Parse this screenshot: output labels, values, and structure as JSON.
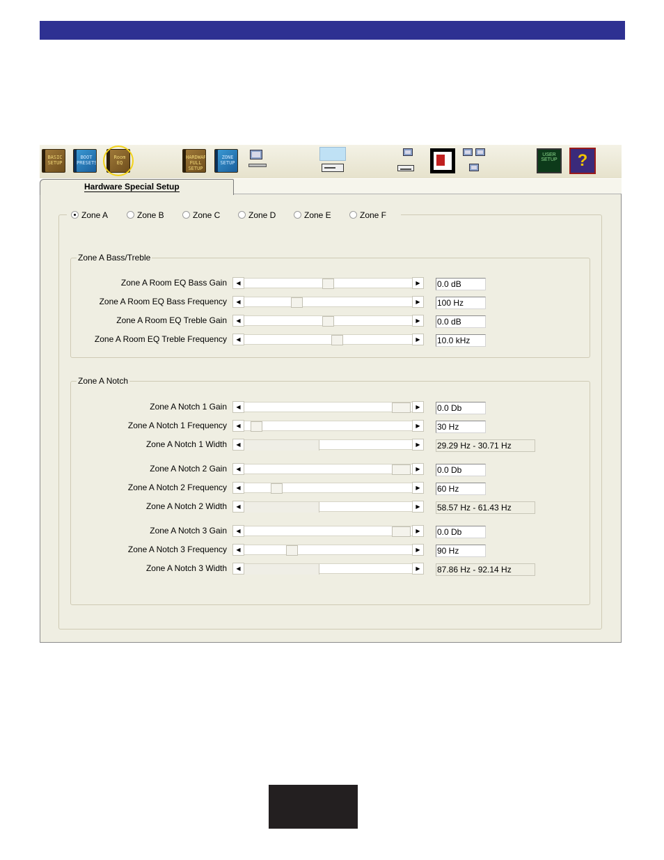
{
  "toolbar": {
    "buttons": [
      {
        "name": "basic-setup",
        "label": "BASIC SETUP"
      },
      {
        "name": "boot-presets",
        "label": "BOOT PRESETS"
      },
      {
        "name": "room-eq",
        "label": "Room EQ",
        "selected": true
      },
      {
        "name": "hardware-full-setup",
        "label": "HARDWARE FULL SETUP"
      },
      {
        "name": "zone-setup",
        "label": "ZONE SETUP"
      },
      {
        "name": "green-screen-label",
        "label": "USER SETUP"
      },
      {
        "name": "help-label",
        "label": "?"
      }
    ]
  },
  "tab": {
    "label": "Hardware Special Setup"
  },
  "zones": {
    "options": [
      "Zone A",
      "Zone B",
      "Zone C",
      "Zone D",
      "Zone E",
      "Zone F"
    ],
    "selected": "Zone A"
  },
  "bass_treble": {
    "title": "Zone A Bass/Treble",
    "rows": [
      {
        "label": "Zone A Room EQ Bass Gain",
        "value": "0.0 dB",
        "position": 0.5
      },
      {
        "label": "Zone A Room EQ Bass Frequency",
        "value": "100 Hz",
        "position": 0.3
      },
      {
        "label": "Zone A Room EQ Treble Gain",
        "value": "0.0 dB",
        "position": 0.5
      },
      {
        "label": "Zone A Room EQ Treble Frequency",
        "value": "10.0 kHz",
        "position": 0.56
      }
    ]
  },
  "notch": {
    "title": "Zone A Notch",
    "rows": [
      {
        "label": "Zone A Notch 1 Gain",
        "value": "0.0 Db",
        "position": 1.0,
        "kind": "gain"
      },
      {
        "label": "Zone A Notch 1 Frequency",
        "value": "30 Hz",
        "position": 0.04,
        "kind": "freq"
      },
      {
        "label": "Zone A Notch 1 Width",
        "value": "29.29 Hz - 30.71 Hz",
        "fill": 0.45,
        "kind": "width"
      },
      {
        "label": "Zone A Notch 2 Gain",
        "value": "0.0 Db",
        "position": 1.0,
        "kind": "gain"
      },
      {
        "label": "Zone A Notch 2 Frequency",
        "value": "60 Hz",
        "position": 0.17,
        "kind": "freq"
      },
      {
        "label": "Zone A Notch 2 Width",
        "value": "58.57 Hz - 61.43 Hz",
        "fill": 0.45,
        "kind": "width"
      },
      {
        "label": "Zone A Notch 3 Gain",
        "value": "0.0 Db",
        "position": 1.0,
        "kind": "gain"
      },
      {
        "label": "Zone A Notch 3 Frequency",
        "value": "90 Hz",
        "position": 0.27,
        "kind": "freq"
      },
      {
        "label": "Zone A Notch 3 Width",
        "value": "87.86 Hz - 92.14 Hz",
        "fill": 0.45,
        "kind": "width"
      }
    ]
  },
  "colors": {
    "header_bar": "#2e3192",
    "panel": "#efeee2",
    "selected_ring": "#f2d21a"
  }
}
